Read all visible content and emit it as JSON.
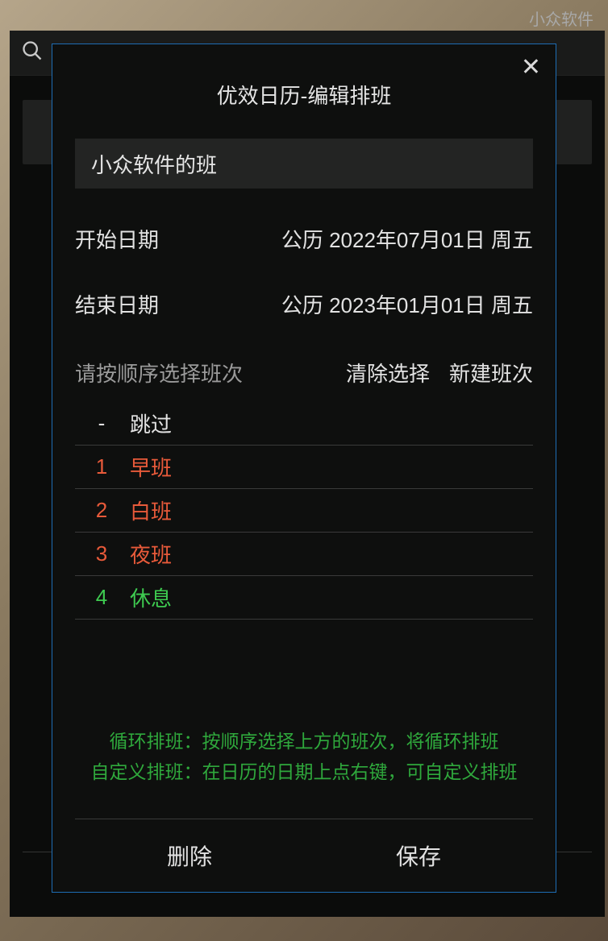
{
  "watermark": "小众软件",
  "search": {
    "placeholder": ""
  },
  "dialog": {
    "title": "优效日历-编辑排班",
    "name_value": "小众软件的班",
    "start_label": "开始日期",
    "start_value": "公历 2022年07月01日 周五",
    "end_label": "结束日期",
    "end_value": "公历 2023年01月01日 周五",
    "shift_header": "请按顺序选择班次",
    "clear_label": "清除选择",
    "new_label": "新建班次",
    "shifts": [
      {
        "num": "-",
        "name": "跳过",
        "color": "#e2e2e2"
      },
      {
        "num": "1",
        "name": "早班",
        "color": "#e85a3a"
      },
      {
        "num": "2",
        "name": "白班",
        "color": "#e85a3a"
      },
      {
        "num": "3",
        "name": "夜班",
        "color": "#e85a3a"
      },
      {
        "num": "4",
        "name": "休息",
        "color": "#3ecb50"
      }
    ],
    "tip1": "循环排班：按顺序选择上方的班次，将循环排班",
    "tip2": "自定义排班：在日历的日期上点右键，可自定义排班",
    "delete_label": "删除",
    "save_label": "保存"
  }
}
